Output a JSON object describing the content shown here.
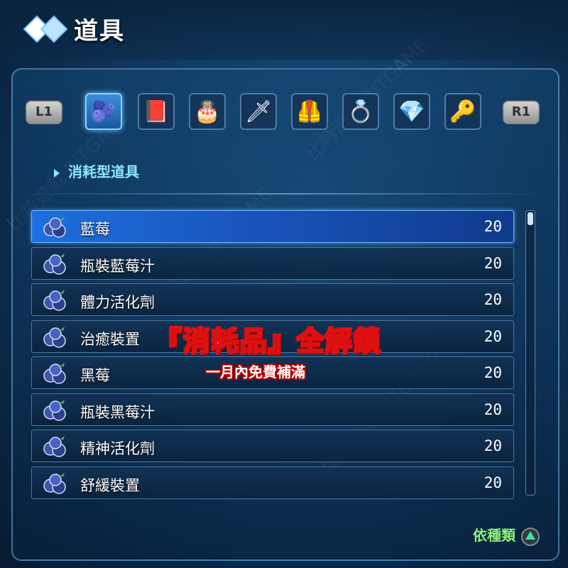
{
  "header": {
    "title": "道具"
  },
  "tabs": {
    "left_shoulder": "L1",
    "right_shoulder": "R1",
    "items": [
      {
        "icon": "blueberry-icon",
        "glyph": "🫐",
        "active": true
      },
      {
        "icon": "book-icon",
        "glyph": "📕",
        "active": false
      },
      {
        "icon": "cake-icon",
        "glyph": "🎂",
        "active": false
      },
      {
        "icon": "sword-icon",
        "glyph": "🗡",
        "active": false
      },
      {
        "icon": "armor-icon",
        "glyph": "🦺",
        "active": false
      },
      {
        "icon": "ring-icon",
        "glyph": "💍",
        "active": false
      },
      {
        "icon": "crystal-icon",
        "glyph": "💎",
        "active": false
      },
      {
        "icon": "key-icon",
        "glyph": "🔑",
        "active": false
      }
    ]
  },
  "category": {
    "label": "消耗型道具"
  },
  "items": [
    {
      "name": "藍莓",
      "qty": "20",
      "selected": true
    },
    {
      "name": "瓶裝藍莓汁",
      "qty": "20",
      "selected": false
    },
    {
      "name": "體力活化劑",
      "qty": "20",
      "selected": false
    },
    {
      "name": "治癒裝置",
      "qty": "20",
      "selected": false
    },
    {
      "name": "黑莓",
      "qty": "20",
      "selected": false
    },
    {
      "name": "瓶裝黑莓汁",
      "qty": "20",
      "selected": false
    },
    {
      "name": "精神活化劑",
      "qty": "20",
      "selected": false
    },
    {
      "name": "舒緩裝置",
      "qty": "20",
      "selected": false
    }
  ],
  "scroll": {
    "position": 0
  },
  "overlay": {
    "main": "『消耗品』全解鎖",
    "sub": "一月內免費補滿"
  },
  "footer": {
    "sort_label": "依種類"
  },
  "watermark": "比特遊戲 BITGAME"
}
